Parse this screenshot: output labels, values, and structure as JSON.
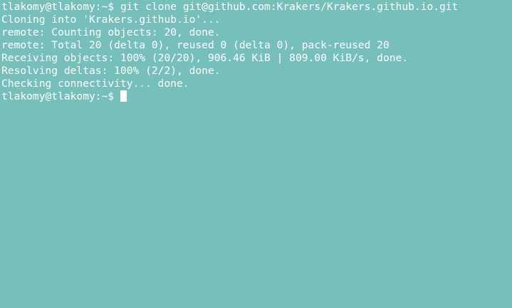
{
  "terminal": {
    "colors": {
      "background": "#77bfba",
      "foreground": "#ffffff"
    },
    "history": [
      {
        "prompt": "tlakomy@tlakomy:~$",
        "command": "git clone git@github.com:Krakers/Krakers.github.io.git"
      }
    ],
    "output": [
      "Cloning into 'Krakers.github.io'...",
      "remote: Counting objects: 20, done.",
      "remote: Total 20 (delta 0), reused 0 (delta 0), pack-reused 20",
      "Receiving objects: 100% (20/20), 906.46 KiB | 809.00 KiB/s, done.",
      "Resolving deltas: 100% (2/2), done.",
      "Checking connectivity... done."
    ],
    "current_prompt": "tlakomy@tlakomy:~$",
    "current_input": ""
  }
}
